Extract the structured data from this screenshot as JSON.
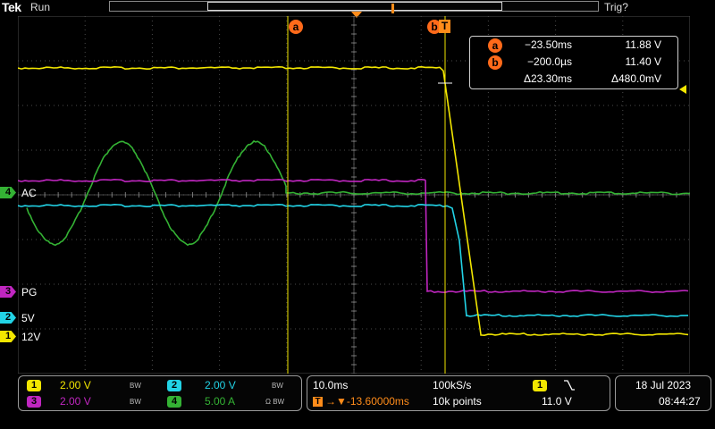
{
  "top": {
    "brand": "Tek",
    "status": "Run",
    "trigger_status": "Trig?"
  },
  "cursors": {
    "a_label": "a",
    "b_label": "b",
    "trigger_marker": "T",
    "a_time": "−23.50ms",
    "a_value": "11.88 V",
    "b_time": "−200.0µs",
    "b_value": "11.40 V",
    "delta_time": "Δ23.30ms",
    "delta_value": "Δ480.0mV"
  },
  "channels": [
    {
      "number": "1",
      "name": "12V",
      "color": "#f2e600",
      "scale": "2.00 V",
      "bw": "BW"
    },
    {
      "number": "2",
      "name": "5V",
      "color": "#22d3e6",
      "scale": "2.00 V",
      "bw": "BW"
    },
    {
      "number": "3",
      "name": "PG",
      "color": "#c026c0",
      "scale": "2.00 V",
      "bw": "BW"
    },
    {
      "number": "4",
      "name": "AC",
      "color": "#34b234",
      "scale": "5.00 A",
      "bw": "Ω BW"
    }
  ],
  "timebase": {
    "scale": "10.0ms",
    "sample_rate": "100kS/s",
    "delay": "→▼-13.60000ms",
    "record_length": "10k points"
  },
  "trigger": {
    "source": "1",
    "slope_icon": "falling-edge-icon",
    "level": "11.0 V"
  },
  "datetime": {
    "date": "18 Jul  2023",
    "time": "08:44:27"
  },
  "colors": {
    "cursor": "#ff6a1a",
    "trigger": "#ff8c1a",
    "grid": "#6e6e6e"
  }
}
